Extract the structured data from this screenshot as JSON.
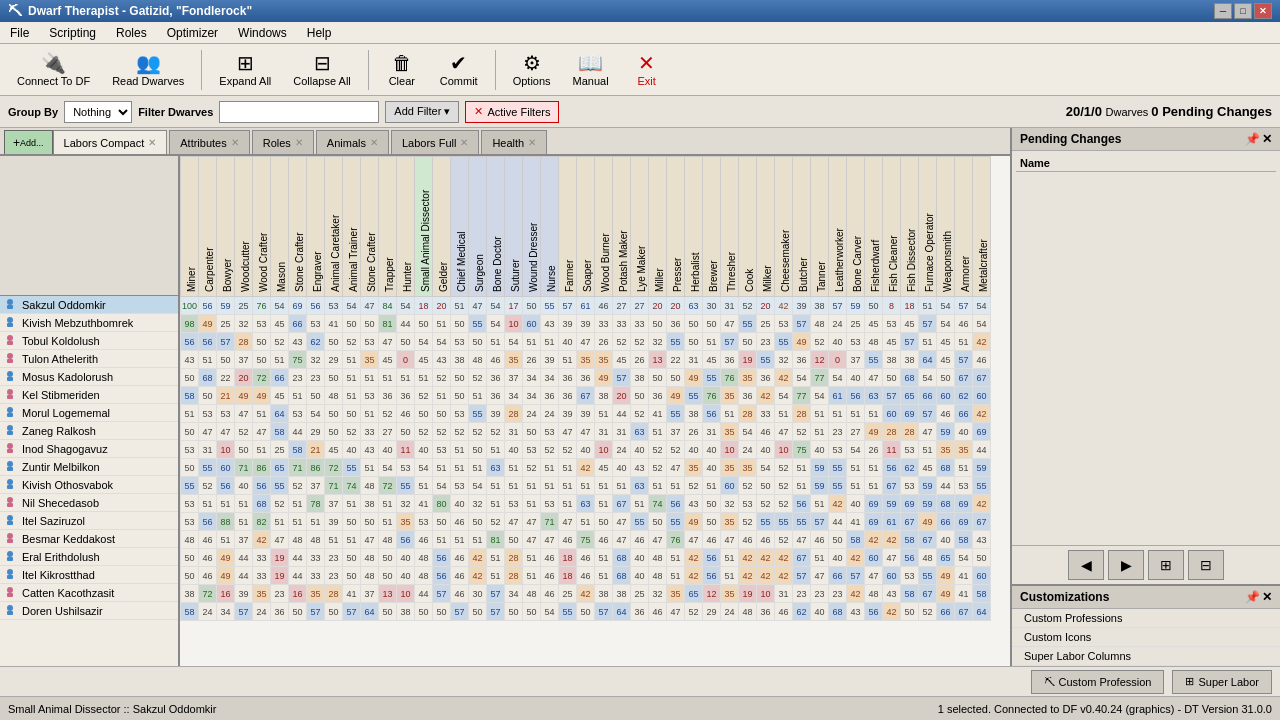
{
  "titlebar": {
    "title": "Dwarf Therapist - Gatizid, \"Fondlerock\"",
    "icon": "⛏"
  },
  "menu": {
    "items": [
      "File",
      "Scripting",
      "Roles",
      "Optimizer",
      "Windows",
      "Help"
    ]
  },
  "toolbar": {
    "connect_label": "Connect To DF",
    "read_label": "Read Dwarves",
    "expand_label": "Expand All",
    "collapse_label": "Collapse All",
    "clear_label": "Clear",
    "commit_label": "Commit",
    "options_label": "Options",
    "manual_label": "Manual",
    "exit_label": "Exit"
  },
  "filterbar": {
    "group_by_label": "Group By",
    "group_by_value": "Nothing",
    "filter_dwarves_label": "Filter Dwarves",
    "add_filter_label": "Add Filter",
    "active_filters_label": "Active Filters",
    "dwarf_count": "20/1/0",
    "dwarves_label": "Dwarves",
    "pending_label": "0  Pending Changes"
  },
  "tabs": [
    {
      "label": "Labors Compact",
      "active": true
    },
    {
      "label": "Attributes",
      "active": false
    },
    {
      "label": "Roles",
      "active": false
    },
    {
      "label": "Animals",
      "active": false
    },
    {
      "label": "Labors Full",
      "active": false
    },
    {
      "label": "Health",
      "active": false
    }
  ],
  "columns": [
    "Miner",
    "Carpenter",
    "Bowyer",
    "Woodcutter",
    "Wood Crafter",
    "Mason",
    "Stone Crafter",
    "Engraver",
    "Animal Caretaker",
    "Animal Trainer",
    "Stone Crafter",
    "Trapper",
    "Hunter",
    "Small Animal Dissector",
    "Gelder",
    "Chief Medical",
    "Surgeon",
    "Bone Doctor",
    "Suturer",
    "Wound Dresser",
    "Nurse",
    "Farmer",
    "Soaper",
    "Wood Burner",
    "Potash Maker",
    "Lye Maker",
    "Miller",
    "Presser",
    "Herbalist",
    "Brewer",
    "Thresher",
    "Cook",
    "Milker",
    "Cheesemaker",
    "Butcher",
    "Tanner",
    "Leatherworker",
    "Bone Carver",
    "Fisherdwarf",
    "Fish Cleaner",
    "Fish Dissector",
    "Furnace Operator",
    "Weaponsmith",
    "Armorer",
    "Metalcrafter"
  ],
  "dwarves": [
    {
      "name": "Sakzul Oddomkir",
      "gender": "male",
      "selected": true
    },
    {
      "name": "Kivish Mebzuthbomrek",
      "gender": "male",
      "selected": false
    },
    {
      "name": "Tobul Koldolush",
      "gender": "female",
      "selected": false
    },
    {
      "name": "Tulon Athelerith",
      "gender": "female",
      "selected": false
    },
    {
      "name": "Mosus Kadolorush",
      "gender": "male",
      "selected": false
    },
    {
      "name": "Kel Stibmeriden",
      "gender": "female",
      "selected": false
    },
    {
      "name": "Morul Logememal",
      "gender": "male",
      "selected": false
    },
    {
      "name": "Zaneg Ralkosh",
      "gender": "male",
      "selected": false
    },
    {
      "name": "Inod Shagogavuz",
      "gender": "female",
      "selected": false
    },
    {
      "name": "Zuntir Melbilkon",
      "gender": "male",
      "selected": false
    },
    {
      "name": "Kivish Othosvabok",
      "gender": "male",
      "selected": false
    },
    {
      "name": "Nil Shecedasob",
      "gender": "female",
      "selected": false
    },
    {
      "name": "Itel Saziruzol",
      "gender": "male",
      "selected": false
    },
    {
      "name": "Besmar Keddakost",
      "gender": "female",
      "selected": false
    },
    {
      "name": "Eral Erithdolush",
      "gender": "male",
      "selected": false
    },
    {
      "name": "Itel Kikrostthad",
      "gender": "male",
      "selected": false
    },
    {
      "name": "Catten Kacothzasit",
      "gender": "female",
      "selected": false
    },
    {
      "name": "Doren Ushilsazir",
      "gender": "male",
      "selected": false
    }
  ],
  "right_panel": {
    "title": "Pending Changes",
    "col_header": "Name"
  },
  "customizations": {
    "title": "Customizations",
    "items": [
      "Custom Professions",
      "Custom Icons",
      "Super Labor Columns"
    ]
  },
  "status_bar": {
    "left": "Small Animal Dissector :: Sakzul Oddomkir",
    "right": "1 selected.  Connected to DF v0.40.24 (graphics) - DT Version 31.0.0"
  },
  "bottom_buttons": {
    "custom_profession": "Custom Profession",
    "super_labor": "Super Labor"
  },
  "colors": {
    "accent_blue": "#4a7ab5",
    "selected_row": "#c0d8e8",
    "tab_active": "#f0ece4"
  }
}
